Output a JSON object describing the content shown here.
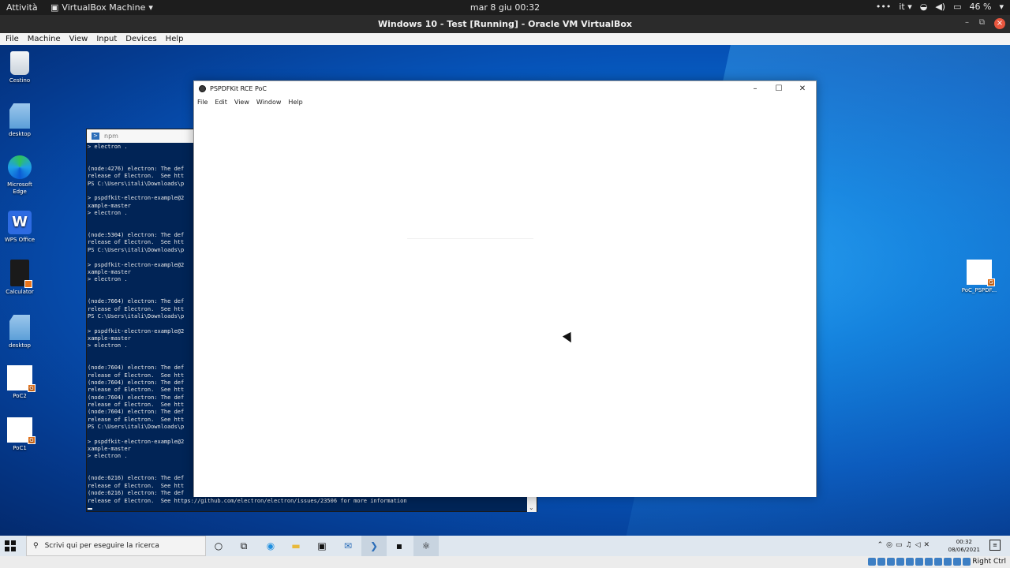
{
  "host": {
    "activities": "Attività",
    "app_name": "VirtualBox Machine",
    "clock": "mar 8 giu  00:32",
    "lang": "it",
    "battery": "46 %"
  },
  "vbox": {
    "title": "Windows 10 - Test [Running] - Oracle VM VirtualBox",
    "menu": [
      "File",
      "Machine",
      "View",
      "Input",
      "Devices",
      "Help"
    ],
    "status_key": "Right Ctrl"
  },
  "desktop_icons": [
    {
      "label": "Cestino",
      "icon": "recycle-bin-icon"
    },
    {
      "label": "desktop",
      "icon": "folder-icon"
    },
    {
      "label": "Microsoft Edge",
      "icon": "edge-icon"
    },
    {
      "label": "WPS Office",
      "icon": "wps-icon"
    },
    {
      "label": "Calculator",
      "icon": "calculator-icon"
    },
    {
      "label": "desktop",
      "icon": "folder-icon"
    },
    {
      "label": "PoC2",
      "icon": "document-icon"
    },
    {
      "label": "PoC1",
      "icon": "document-icon"
    },
    {
      "label": "PoC_PSPDF...",
      "icon": "document-icon"
    }
  ],
  "terminal": {
    "title": "npm",
    "lines": [
      "> electron .",
      "",
      "",
      "(node:4276) electron: The def",
      "release of Electron.  See htt",
      "PS C:\\Users\\itali\\Downloads\\p",
      "",
      "> pspdfkit-electron-example@2",
      "xample-master",
      "> electron .",
      "",
      "",
      "(node:5304) electron: The def",
      "release of Electron.  See htt",
      "PS C:\\Users\\itali\\Downloads\\p",
      "",
      "> pspdfkit-electron-example@2",
      "xample-master",
      "> electron .",
      "",
      "",
      "(node:7664) electron: The def",
      "release of Electron.  See htt",
      "PS C:\\Users\\itali\\Downloads\\p",
      "",
      "> pspdfkit-electron-example@2",
      "xample-master",
      "> electron .",
      "",
      "",
      "(node:7604) electron: The def",
      "release of Electron.  See htt",
      "(node:7604) electron: The def",
      "release of Electron.  See htt",
      "(node:7604) electron: The def",
      "release of Electron.  See htt",
      "(node:7604) electron: The def",
      "release of Electron.  See htt",
      "PS C:\\Users\\itali\\Downloads\\p",
      "",
      "> pspdfkit-electron-example@2",
      "xample-master",
      "> electron .",
      "",
      "",
      "(node:6216) electron: The def",
      "release of Electron.  See htt",
      "(node:6216) electron: The def",
      "release of Electron.  See https://github.com/electron/electron/issues/23506 for more information"
    ]
  },
  "app": {
    "title": "PSPDFKit RCE PoC",
    "menu": [
      "File",
      "Edit",
      "View",
      "Window",
      "Help"
    ]
  },
  "taskbar": {
    "search_placeholder": "Scrivi qui per eseguire la ricerca",
    "time": "00:32",
    "date": "08/06/2021"
  }
}
